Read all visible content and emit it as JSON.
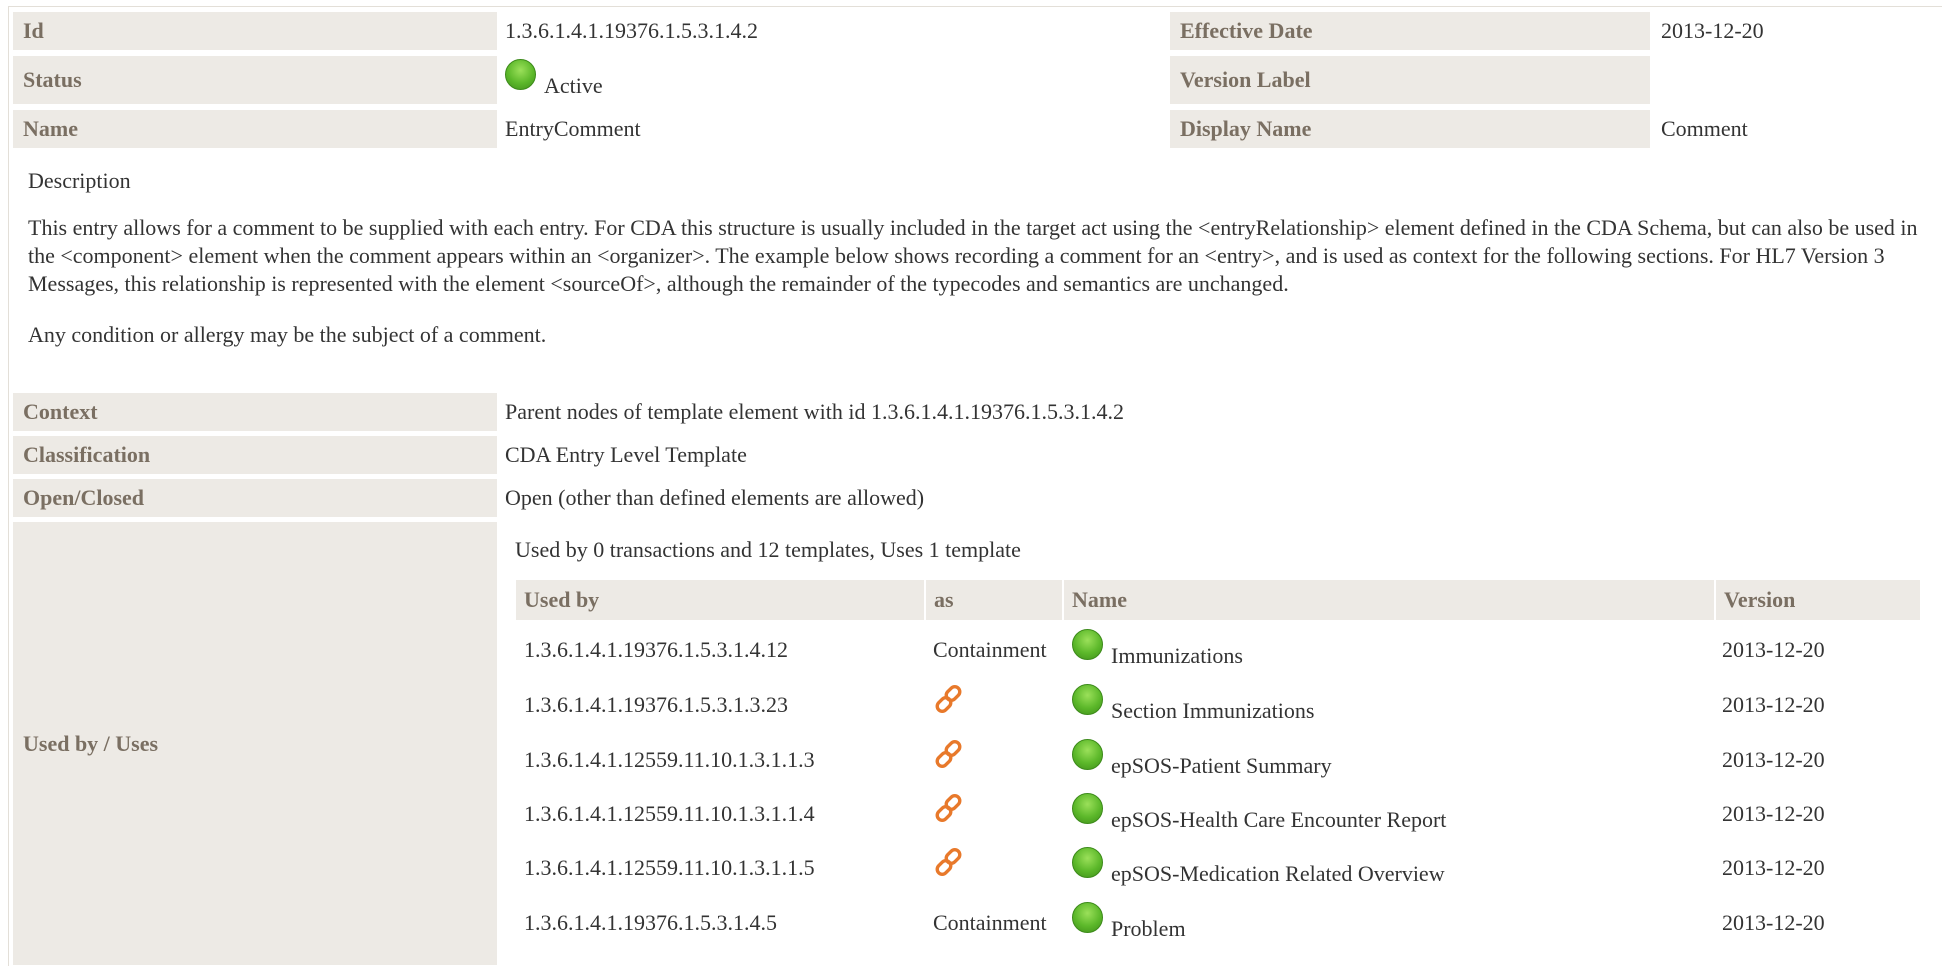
{
  "top_table": {
    "id_label": "Id",
    "id_value": "1.3.6.1.4.1.19376.1.5.3.1.4.2",
    "effective_date_label": "Effective Date",
    "effective_date_value": "2013-12-20",
    "status_label": "Status",
    "status_value": "Active",
    "version_label_label": "Version Label",
    "version_label_value": "",
    "name_label": "Name",
    "name_value": "EntryComment",
    "display_name_label": "Display Name",
    "display_name_value": "Comment"
  },
  "description": {
    "heading": "Description",
    "paragraph1": "This entry allows for a comment to be supplied with each entry. For CDA this structure is usually included in the target act using the <entryRelationship> element defined in the CDA Schema, but can also be used in the <component> element when the comment appears within an <organizer>. The example below shows recording a comment for an <entry>, and is used as context for the following sections. For HL7 Version 3 Messages, this relationship is represented with the element <sourceOf>, although the remainder of the typecodes and semantics are unchanged.",
    "paragraph2": "Any condition or allergy may be the subject of a comment."
  },
  "properties": {
    "context_label": "Context",
    "context_value": "Parent nodes of template element with id 1.3.6.1.4.1.19376.1.5.3.1.4.2",
    "classification_label": "Classification",
    "classification_value": "CDA Entry Level Template",
    "open_closed_label": "Open/Closed",
    "open_closed_value": "Open (other than defined elements are allowed)",
    "used_by_uses_label": "Used by / Uses"
  },
  "usage": {
    "summary": "Used by 0 transactions and 12 templates, Uses 1 template",
    "headers": {
      "used_by": "Used by",
      "as": "as",
      "name": "Name",
      "version": "Version"
    },
    "rows": [
      {
        "id": "1.3.6.1.4.1.19376.1.5.3.1.4.12",
        "as": "Containment",
        "as_icon": "",
        "name": "Immunizations",
        "version": "2013-12-20"
      },
      {
        "id": "1.3.6.1.4.1.19376.1.5.3.1.3.23",
        "as": "",
        "as_icon": "link-icon",
        "name": "Section Immunizations",
        "version": "2013-12-20"
      },
      {
        "id": "1.3.6.1.4.1.12559.11.10.1.3.1.1.3",
        "as": "",
        "as_icon": "link-icon",
        "name": "epSOS-Patient Summary",
        "version": "2013-12-20"
      },
      {
        "id": "1.3.6.1.4.1.12559.11.10.1.3.1.1.4",
        "as": "",
        "as_icon": "link-icon",
        "name": "epSOS-Health Care Encounter Report",
        "version": "2013-12-20"
      },
      {
        "id": "1.3.6.1.4.1.12559.11.10.1.3.1.1.5",
        "as": "",
        "as_icon": "link-icon",
        "name": "epSOS-Medication Related Overview",
        "version": "2013-12-20"
      },
      {
        "id": "1.3.6.1.4.1.19376.1.5.3.1.4.5",
        "as": "Containment",
        "as_icon": "",
        "name": "Problem",
        "version": "2013-12-20"
      }
    ]
  },
  "colors": {
    "label_bg": "#edeae5",
    "label_text": "#7a6f62",
    "status_active": "#5cb82a",
    "link_icon": "#e8792b"
  }
}
